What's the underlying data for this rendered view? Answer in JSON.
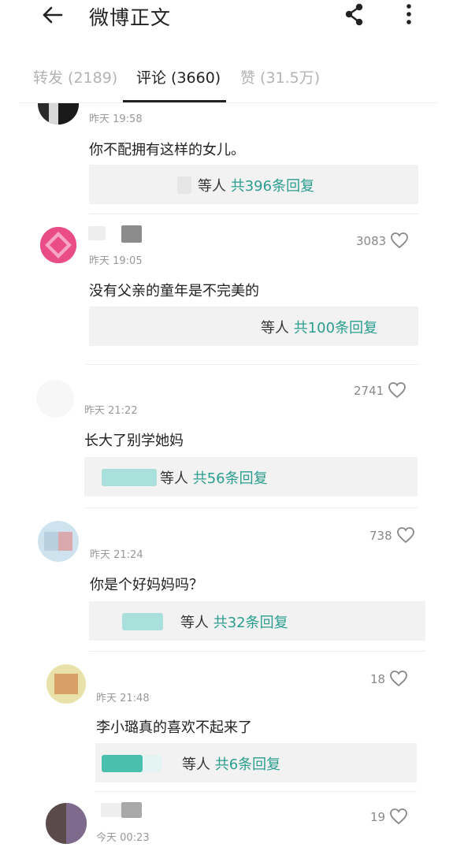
{
  "header": {
    "title": "微博正文",
    "back_icon": "arrow-left-icon",
    "share_icon": "share-icon",
    "more_icon": "more-vertical-icon"
  },
  "tabs": [
    {
      "label": "转发 (2189)",
      "active": false
    },
    {
      "label": "评论 (3660)",
      "active": true
    },
    {
      "label": "赞 (31.5万)",
      "active": false
    }
  ],
  "colors": {
    "accent": "#2a9d8f",
    "reply_bg": "#f2f2f2",
    "muted_text": "#999999"
  },
  "comments": [
    {
      "time": "昨天 19:58",
      "text": "你不配拥有这样的女儿。",
      "likes": "",
      "reply_prefix": "等人",
      "reply_count": "共396条回复"
    },
    {
      "time": "昨天 19:05",
      "text": "没有父亲的童年是不完美的",
      "likes": "3083",
      "reply_prefix": "等人",
      "reply_count": "共100条回复"
    },
    {
      "time": "昨天 21:22",
      "text": "长大了别学她妈",
      "likes": "2741",
      "reply_prefix": "等人",
      "reply_count": "共56条回复"
    },
    {
      "time": "昨天 21:24",
      "text": "你是个好妈妈吗？",
      "likes": "738",
      "reply_prefix": "等人",
      "reply_count": "共32条回复"
    },
    {
      "time": "昨天 21:48",
      "text": "李小璐真的喜欢不起来了",
      "likes": "18",
      "reply_prefix": "等人",
      "reply_count": "共6条回复"
    },
    {
      "time": "今天 00:23",
      "text": "",
      "likes": "19",
      "reply_prefix": "",
      "reply_count": ""
    }
  ]
}
